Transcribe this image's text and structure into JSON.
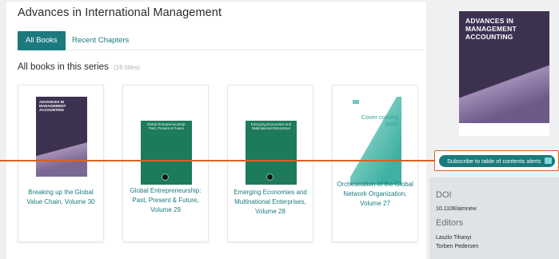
{
  "series": {
    "title": "Advances in International Management"
  },
  "tabs": [
    {
      "label": "All Books",
      "active": true
    },
    {
      "label": "Recent Chapters",
      "active": false
    }
  ],
  "section": {
    "heading": "All books in this series",
    "count": "(16 titles)"
  },
  "books": [
    {
      "cover_type": "accounting",
      "cover_title": "ADVANCES IN MANAGEMENT ACCOUNTING",
      "caption": "Breaking up the Global Value Chain, Volume 30"
    },
    {
      "cover_type": "green",
      "cover_title": "Global Entrepreneurship: Past, Present & Future",
      "caption": "Global Entrepreneurship: Past, Present & Future, Volume 29"
    },
    {
      "cover_type": "green",
      "cover_title": "Emerging Economies and Multinational Enterprises",
      "caption": "Emerging Economies and Multinational Enterprises, Volume 28"
    },
    {
      "cover_type": "coming-soon",
      "cover_title": "Cover coming soon",
      "caption": "Orchestration of the Global Network Organization, Volume 27"
    }
  ],
  "sidebar": {
    "cover_title": "ADVANCES IN MANAGEMENT ACCOUNTING",
    "subscribe_label": "Subscribe to table of contents alerts",
    "doi_heading": "DOI",
    "doi_value": "10.1108/aimnew",
    "editors_heading": "Editors",
    "editors": [
      "Laszlo Tihanyi",
      "Torben Pedersen"
    ]
  },
  "colors": {
    "accent": "#1a7a7e",
    "callout": "#d9631b",
    "cover_purple": "#3d3150",
    "cover_green": "#1d7a5d"
  }
}
